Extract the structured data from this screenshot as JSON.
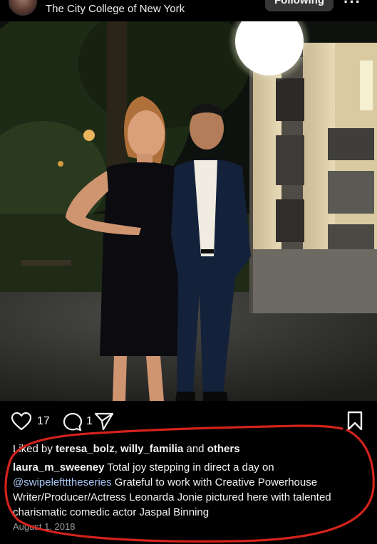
{
  "header": {
    "location": "The City College of New York",
    "follow_label": "Following",
    "more_label": "···"
  },
  "actions": {
    "likes_count": "17",
    "comments_count": "1"
  },
  "caption": {
    "liked_by_prefix": "Liked by",
    "liked_by_user1": "teresa_bolz",
    "liked_by_sep": ",",
    "liked_by_user2": "willy_familia",
    "liked_by_and": "and",
    "liked_by_others": "others",
    "username": "laura_m_sweeney",
    "text_part1": "Total joy stepping in direct a day on",
    "mention": "@swipeleftttheseries",
    "text_part2": "Grateful to work with Creative Powerhouse Writer/Producer/Actress Leonarda Jonie pictured here with talented charismatic comedic actor Jaspal Binning",
    "date": "August 1, 2018"
  },
  "colors": {
    "background": "#000000",
    "mention": "#a9c8f5",
    "annotation": "#d3221c"
  }
}
